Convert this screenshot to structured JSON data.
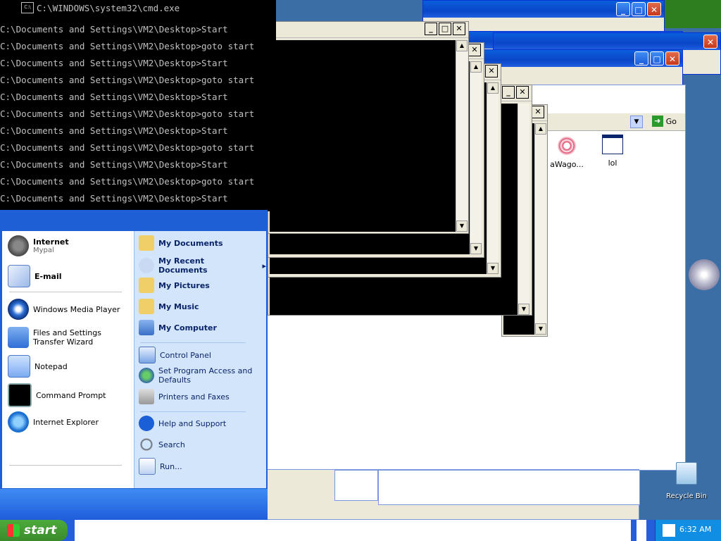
{
  "console": {
    "title": "C:\\WINDOWS\\system32\\cmd.exe",
    "title_icon": "C:\\",
    "lines": [
      "C:\\Documents and Settings\\VM2\\Desktop>Start",
      "C:\\Documents and Settings\\VM2\\Desktop>goto start",
      "C:\\Documents and Settings\\VM2\\Desktop>Start",
      "C:\\Documents and Settings\\VM2\\Desktop>goto start",
      "C:\\Documents and Settings\\VM2\\Desktop>Start",
      "C:\\Documents and Settings\\VM2\\Desktop>goto start",
      "C:\\Documents and Settings\\VM2\\Desktop>Start",
      "C:\\Documents and Settings\\VM2\\Desktop>goto start",
      "C:\\Documents and Settings\\VM2\\Desktop>Start",
      "C:\\Documents and Settings\\VM2\\Desktop>goto start",
      "C:\\Documents and Settings\\VM2\\Desktop>Start"
    ]
  },
  "controls": {
    "minimize": "_",
    "maximize": "□",
    "close": "✕",
    "scroll_up": "▲",
    "scroll_down": "▼",
    "dropdown": "▼"
  },
  "explorer": {
    "go_label": "Go",
    "files": [
      {
        "label": "aWago..."
      },
      {
        "label": "lol"
      }
    ]
  },
  "start_menu": {
    "pinned": [
      {
        "label": "Internet",
        "sub": "Mypal",
        "icon": "browser-icon"
      },
      {
        "label": "E-mail",
        "sub": "",
        "icon": "email-icon"
      }
    ],
    "recent": [
      {
        "label": "Windows Media Player",
        "icon": "media-player-icon"
      },
      {
        "label": "Files and Settings Transfer Wizard",
        "icon": "transfer-wizard-icon"
      },
      {
        "label": "Notepad",
        "icon": "notepad-icon"
      },
      {
        "label": "Command Prompt",
        "icon": "command-prompt-icon"
      },
      {
        "label": "Internet Explorer",
        "icon": "internet-explorer-icon"
      }
    ],
    "places": [
      {
        "label": "My Documents"
      },
      {
        "label": "My Recent Documents",
        "arrow": "▸"
      },
      {
        "label": "My Pictures"
      },
      {
        "label": "My Music"
      },
      {
        "label": "My Computer"
      }
    ],
    "system": [
      {
        "label": "Control Panel"
      },
      {
        "label": "Set Program Access and Defaults"
      },
      {
        "label": "Printers and Faxes"
      }
    ],
    "help": [
      {
        "label": "Help and Support"
      },
      {
        "label": "Search"
      },
      {
        "label": "Run..."
      }
    ]
  },
  "desktop": {
    "recycle_bin": "Recycle Bin"
  },
  "taskbar": {
    "start": "start",
    "clock": "6:32 AM"
  },
  "colors": {
    "xp_blue": "#245edb",
    "start_green": "#3b8a2c",
    "menu_right": "#d3e5fa"
  }
}
